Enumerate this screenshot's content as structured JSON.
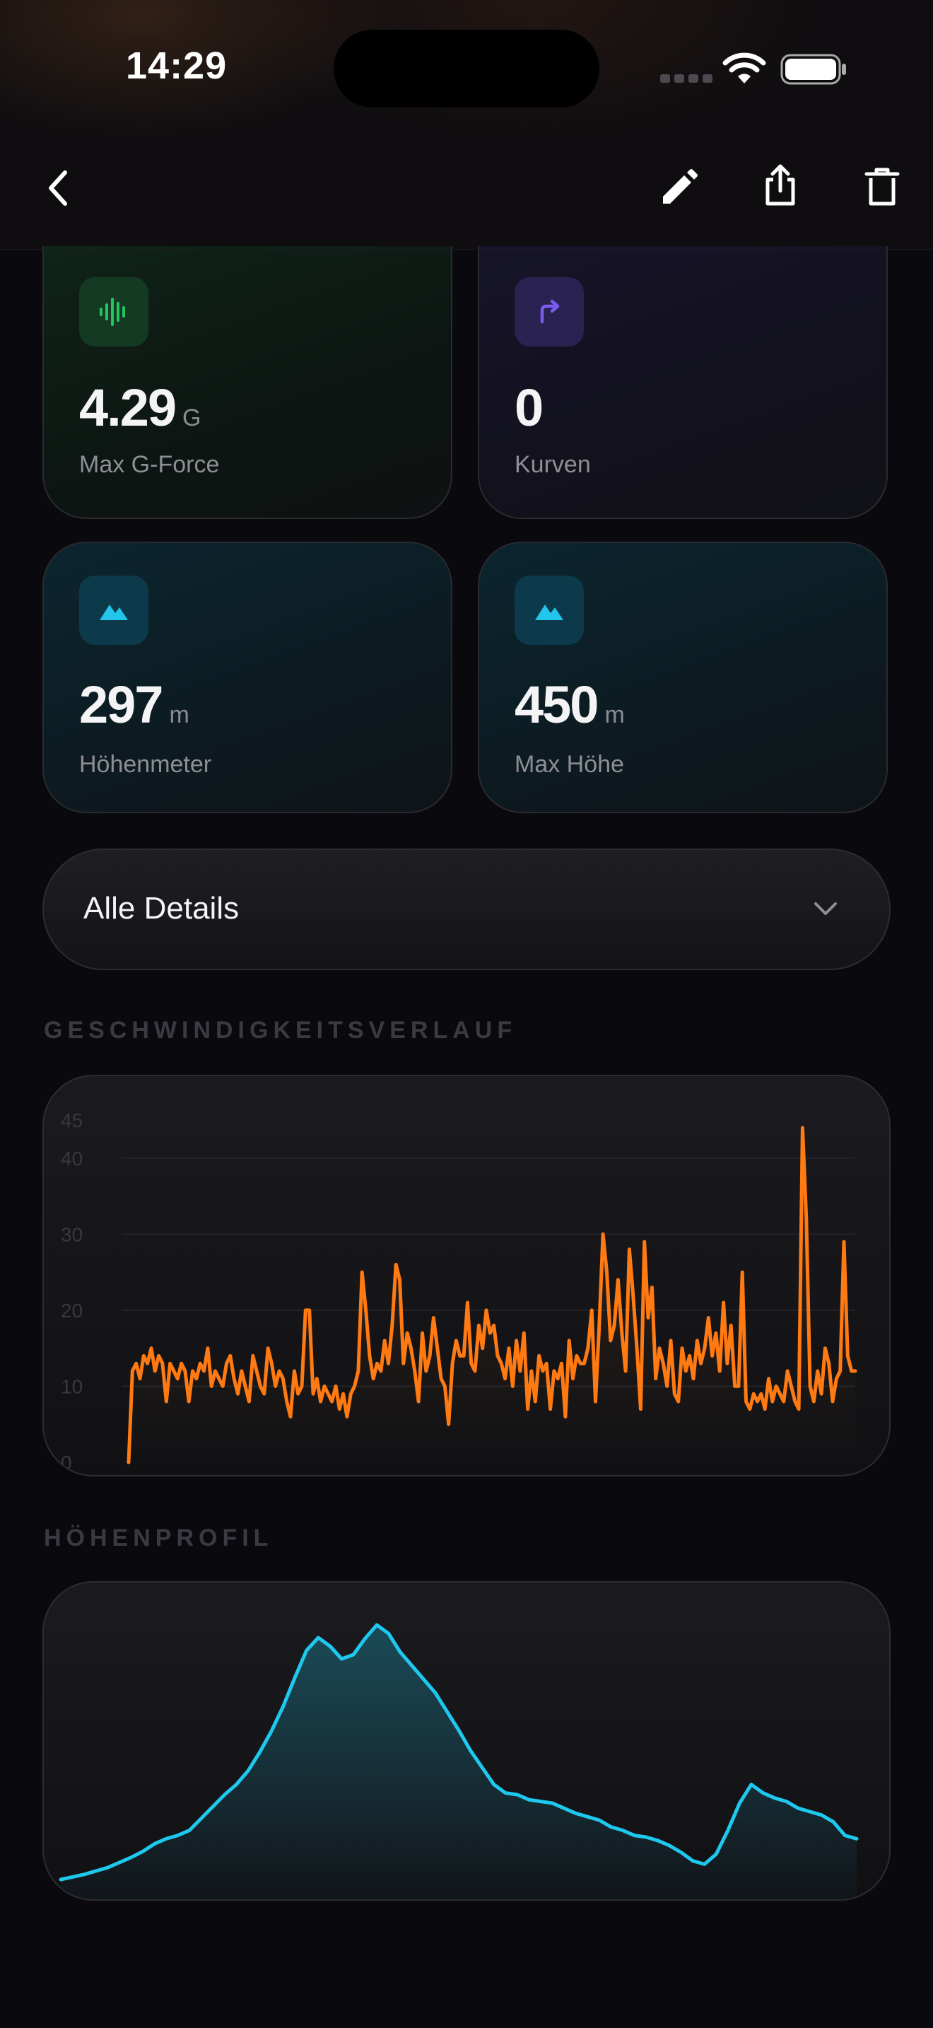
{
  "status_bar": {
    "time": "14:29"
  },
  "nav": {
    "back_icon": "chevron-left-icon",
    "actions": [
      "pencil-icon",
      "share-icon",
      "trash-icon"
    ]
  },
  "stats": [
    {
      "value": "4.29",
      "unit": "G",
      "label": "Max G-Force",
      "icon": "waveform-icon",
      "color": "#22c55e"
    },
    {
      "value": "0",
      "unit": "",
      "label": "Kurven",
      "icon": "turn-right-arrow-icon",
      "color": "#7c5cf0"
    },
    {
      "value": "297",
      "unit": "m",
      "label": "Höhenmeter",
      "icon": "mountain-icon",
      "color": "#22c6ea"
    },
    {
      "value": "450",
      "unit": "m",
      "label": "Max Höhe",
      "icon": "mountain-icon",
      "color": "#22c6ea"
    }
  ],
  "details": {
    "label": "Alle Details"
  },
  "speed_section": {
    "title": "GESCHWINDIGKEITSVERLAUF"
  },
  "elevation_section": {
    "title": "HÖHENPROFIL"
  },
  "chart_data": [
    {
      "type": "line",
      "color": "#ff7a12",
      "ylim": [
        0,
        45
      ],
      "yticks": [
        0,
        10,
        20,
        30,
        40,
        45
      ],
      "grid": true,
      "values": [
        0,
        12,
        13,
        11,
        14,
        13,
        15,
        12,
        14,
        13,
        8,
        13,
        12,
        11,
        13,
        12,
        8,
        12,
        11,
        13,
        12,
        15,
        10,
        12,
        11,
        10,
        13,
        14,
        11,
        9,
        12,
        10,
        8,
        14,
        12,
        10,
        9,
        15,
        13,
        10,
        12,
        11,
        8,
        6,
        12,
        9,
        10,
        20,
        20,
        9,
        11,
        8,
        10,
        9,
        8,
        10,
        7,
        9,
        6,
        9,
        10,
        12,
        25,
        20,
        14,
        11,
        13,
        12,
        16,
        13,
        18,
        26,
        24,
        13,
        17,
        15,
        12,
        8,
        17,
        12,
        14,
        19,
        15,
        11,
        10,
        5,
        13,
        16,
        14,
        14,
        21,
        13,
        12,
        18,
        15,
        20,
        17,
        18,
        14,
        13,
        11,
        15,
        10,
        16,
        12,
        17,
        7,
        12,
        8,
        14,
        12,
        13,
        7,
        12,
        11,
        13,
        6,
        16,
        11,
        14,
        13,
        13,
        15,
        20,
        8,
        18,
        30,
        25,
        16,
        18,
        24,
        17,
        12,
        28,
        22,
        15,
        7,
        29,
        19,
        23,
        11,
        15,
        13,
        10,
        16,
        9,
        8,
        15,
        12,
        14,
        11,
        16,
        13,
        15,
        19,
        14,
        17,
        12,
        21,
        13,
        18,
        10,
        10,
        25,
        8,
        7,
        9,
        8,
        9,
        7,
        11,
        8,
        10,
        9,
        8,
        12,
        10,
        8,
        7,
        44,
        32,
        10,
        8,
        12,
        9,
        15,
        13,
        8,
        11,
        12,
        29,
        14,
        12,
        12
      ]
    },
    {
      "type": "area",
      "color": "#1ec8ee",
      "values": [
        0,
        3,
        6,
        10,
        14,
        20,
        26,
        33,
        42,
        48,
        52,
        58,
        72,
        86,
        100,
        112,
        128,
        150,
        175,
        204,
        238,
        270,
        285,
        275,
        260,
        265,
        284,
        300,
        290,
        268,
        252,
        236,
        220,
        198,
        176,
        152,
        132,
        112,
        102,
        100,
        94,
        92,
        90,
        84,
        78,
        74,
        70,
        62,
        58,
        52,
        50,
        46,
        40,
        32,
        22,
        18,
        30,
        58,
        90,
        112,
        102,
        96,
        92,
        84,
        80,
        76,
        68,
        52,
        48
      ]
    }
  ]
}
